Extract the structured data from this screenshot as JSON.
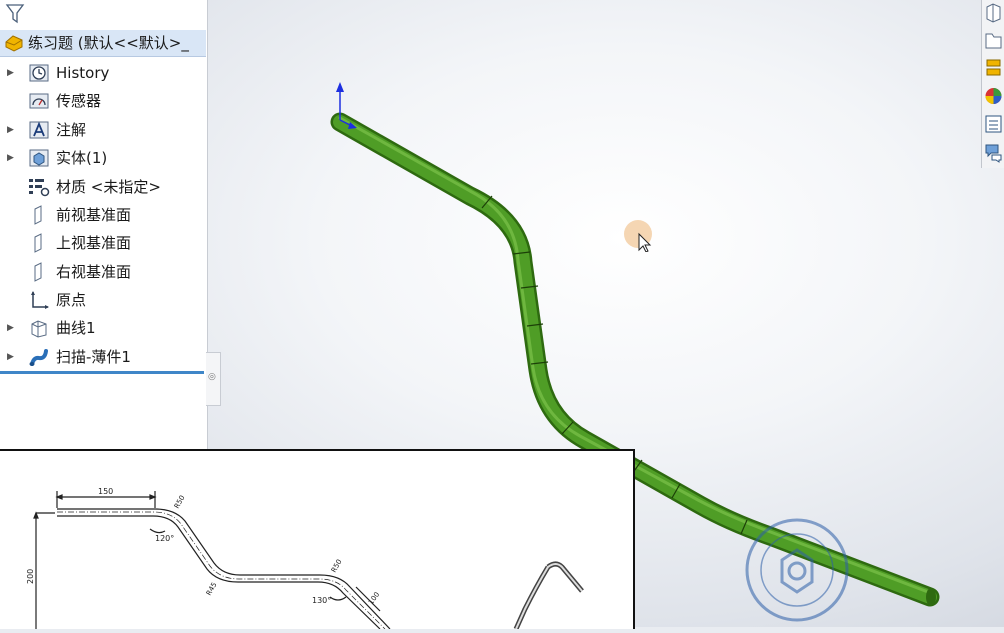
{
  "feature_tree": {
    "root_label": "练习题 (默认<<默认>_",
    "items": [
      {
        "label": "History",
        "icon": "history-icon",
        "expandable": true
      },
      {
        "label": "传感器",
        "icon": "sensor-icon",
        "expandable": false
      },
      {
        "label": "注解",
        "icon": "annotation-icon",
        "expandable": true
      },
      {
        "label": "实体(1)",
        "icon": "solid-body-icon",
        "expandable": true
      },
      {
        "label": "材质 <未指定>",
        "icon": "material-icon",
        "expandable": false
      },
      {
        "label": "前视基准面",
        "icon": "plane-icon",
        "expandable": false
      },
      {
        "label": "上视基准面",
        "icon": "plane-icon",
        "expandable": false
      },
      {
        "label": "右视基准面",
        "icon": "plane-icon",
        "expandable": false
      },
      {
        "label": "原点",
        "icon": "origin-icon",
        "expandable": false
      },
      {
        "label": "曲线1",
        "icon": "curve-icon",
        "expandable": true
      },
      {
        "label": "扫描-薄件1",
        "icon": "sweep-icon",
        "expandable": true
      }
    ]
  },
  "drawing": {
    "dim_length": "150",
    "dim_height": "200",
    "dim_radius_1": "R50",
    "dim_radius_2": "R45",
    "dim_radius_3": "R50",
    "angle_1": "120°",
    "angle_2": "130°",
    "dim_extra": "100"
  },
  "colors": {
    "accent": "#3f86c8",
    "tube": "#3f8a1a",
    "tree_selected": "#d9e6f6"
  },
  "right_toolbar": [
    "view-icon",
    "folder-icon",
    "design-library-icon",
    "appearance-icon",
    "properties-icon",
    "forum-icon"
  ]
}
